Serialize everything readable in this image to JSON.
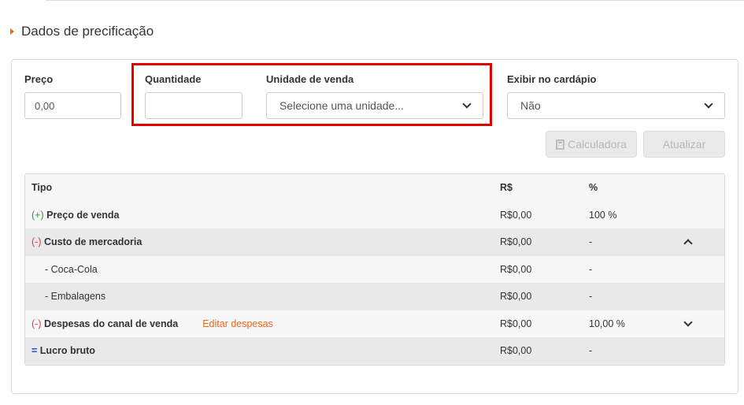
{
  "section": {
    "title": "Dados de precificação"
  },
  "form": {
    "preco": {
      "label": "Preço",
      "value": "0,00"
    },
    "quantidade": {
      "label": "Quantidade",
      "value": ""
    },
    "unidade": {
      "label": "Unidade de venda",
      "selected": "Selecione uma unidade..."
    },
    "exibir": {
      "label": "Exibir no cardápio",
      "selected": "Não"
    }
  },
  "buttons": {
    "calculadora": "Calculadora",
    "atualizar": "Atualizar"
  },
  "table": {
    "headers": {
      "tipo": "Tipo",
      "rs": "R$",
      "pct": "%"
    },
    "rows": [
      {
        "prefix": "(+)",
        "label": "Preço de venda",
        "rs": "R$0,00",
        "pct": "100 %"
      },
      {
        "prefix": "(-)",
        "label": "Custo de mercadoria",
        "rs": "R$0,00",
        "pct": "-"
      },
      {
        "label": "- Coca-Cola",
        "rs": "R$0,00",
        "pct": "-"
      },
      {
        "label": "- Embalagens",
        "rs": "R$0,00",
        "pct": "-"
      },
      {
        "prefix": "(-)",
        "label": "Despesas do canal de venda",
        "link": "Editar despesas",
        "rs": "R$0,00",
        "pct": "10,00 %"
      },
      {
        "prefix": "=",
        "label": "Lucro bruto",
        "rs": "R$0,00",
        "pct": "-"
      }
    ]
  },
  "colors": {
    "accent": "#e8671c",
    "highlight": "#e00000",
    "positive": "#2ca02c",
    "negative": "#e53935",
    "total": "#1a3bd6"
  }
}
